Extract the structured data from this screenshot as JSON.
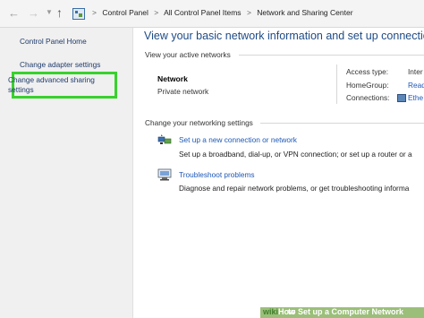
{
  "breadcrumb": {
    "items": [
      "Control Panel",
      "All Control Panel Items",
      "Network and Sharing Center"
    ],
    "separator": ">"
  },
  "nav": {
    "back_icon": "arrow-left-icon",
    "forward_icon": "arrow-right-icon",
    "recent_icon": "chevron-down-icon",
    "up_icon": "arrow-up-icon"
  },
  "sidebar": {
    "home": "Control Panel Home",
    "change_adapter": "Change adapter settings",
    "change_advanced_line1": "Change advanced sharing",
    "change_advanced_line2": "settings",
    "highlight_color": "#39d12d"
  },
  "main": {
    "title": "View your basic network information and set up connections",
    "active_networks_label": "View your active networks",
    "network": {
      "name": "Network",
      "type": "Private network",
      "access_type_label": "Access type:",
      "access_type_value": "Inter",
      "homegroup_label": "HomeGroup:",
      "homegroup_value": "Read",
      "connections_label": "Connections:",
      "connections_value": "Ethe"
    },
    "change_settings_label": "Change your networking settings",
    "tasks": [
      {
        "link": "Set up a new connection or network",
        "desc": "Set up a broadband, dial-up, or VPN connection; or set up a router or a",
        "icon": "network-setup-icon"
      },
      {
        "link": "Troubleshoot problems",
        "desc": "Diagnose and repair network problems, or get troubleshooting informa",
        "icon": "troubleshoot-icon"
      }
    ]
  },
  "watermark": {
    "brand_a": "wiki",
    "brand_b": "How",
    "text": "to Set up a Computer Network"
  }
}
